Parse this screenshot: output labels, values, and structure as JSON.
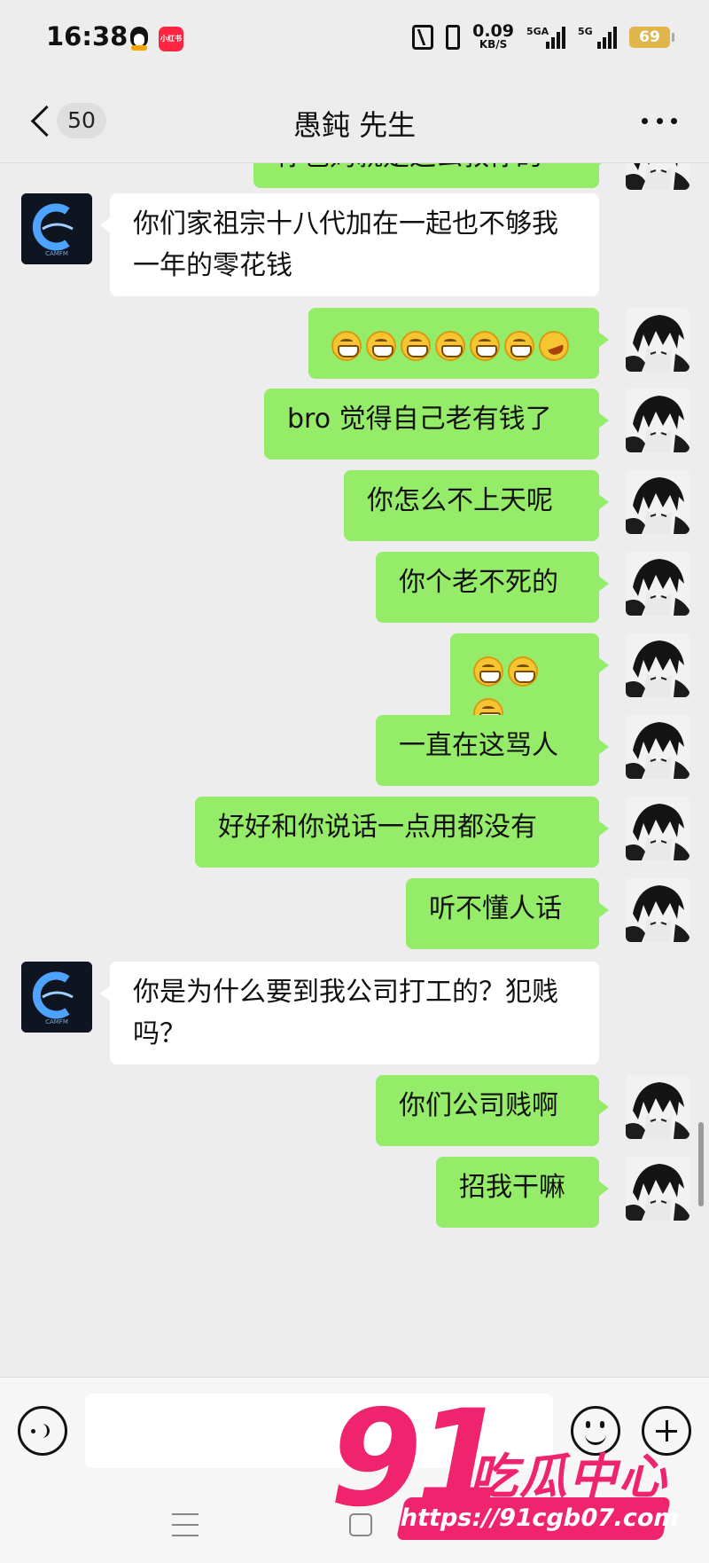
{
  "status_bar": {
    "time": "16:38",
    "net_speed": "0.09",
    "net_unit": "KB/S",
    "signal1_tag": "5GA",
    "signal2_tag": "5G",
    "battery": "69",
    "app_icons": [
      "qq-icon",
      "xiaohongshu-icon"
    ],
    "redbook_label": "小红书"
  },
  "nav": {
    "unread_count": "50",
    "title": "愚鈍 先生"
  },
  "messages": [
    {
      "side": "sent",
      "text": "你爸妈就是这么教你的"
    },
    {
      "side": "recv",
      "text": "你们家祖宗十八代加在一起也不够我一年的零花钱"
    },
    {
      "side": "sent",
      "emoji": [
        "grin",
        "grin",
        "grin",
        "grin",
        "grin",
        "grin",
        "laugh"
      ]
    },
    {
      "side": "sent",
      "text": "bro 觉得自己老有钱了"
    },
    {
      "side": "sent",
      "text": "你怎么不上天呢"
    },
    {
      "side": "sent",
      "text": "你个老不死的"
    },
    {
      "side": "sent",
      "emoji": [
        "grin",
        "grin",
        "grin"
      ]
    },
    {
      "side": "sent",
      "text": "一直在这骂人"
    },
    {
      "side": "sent",
      "text": "好好和你说话一点用都没有"
    },
    {
      "side": "sent",
      "text": "听不懂人话"
    },
    {
      "side": "recv",
      "text": "你是为什么要到我公司打工的？犯贱吗？"
    },
    {
      "side": "sent",
      "text": "你们公司贱啊"
    },
    {
      "side": "sent",
      "text": "招我干嘛"
    }
  ],
  "contact_avatar_label": "CAMFM",
  "input": {
    "value": "",
    "placeholder": ""
  },
  "watermark": {
    "number": "91",
    "name": "吃瓜中心",
    "url": "https://91cgb07.com"
  },
  "colors": {
    "sent_bubble": "#95ec69",
    "recv_bubble": "#ffffff",
    "background": "#ededed",
    "watermark": "#f0236e"
  }
}
